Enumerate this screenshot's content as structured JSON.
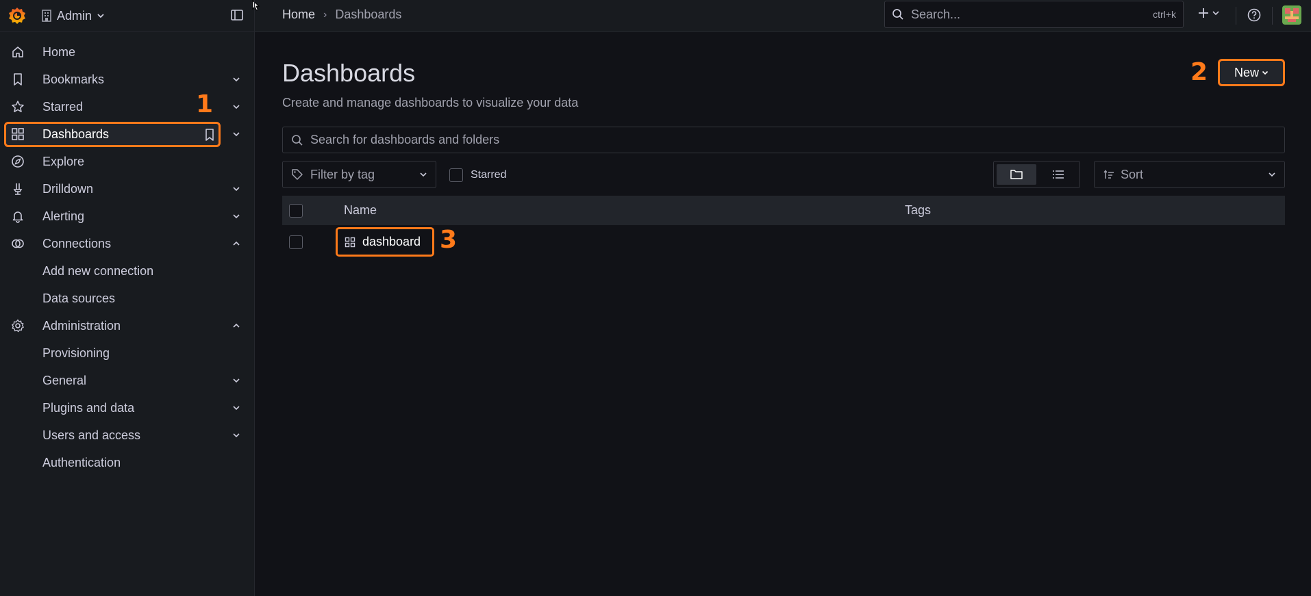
{
  "topbar": {
    "org_name": "Admin",
    "breadcrumb_home": "Home",
    "breadcrumb_separator": "›",
    "breadcrumb_current": "Dashboards",
    "search_placeholder": "Search...",
    "search_shortcut": "ctrl+k",
    "add_label": "+"
  },
  "sidebar": {
    "items": [
      {
        "label": "Home",
        "icon": "home-icon"
      },
      {
        "label": "Bookmarks",
        "icon": "bookmark-icon"
      },
      {
        "label": "Starred",
        "icon": "star-icon"
      },
      {
        "label": "Dashboards",
        "icon": "apps-icon"
      },
      {
        "label": "Explore",
        "icon": "compass-icon"
      },
      {
        "label": "Drilldown",
        "icon": "drilldown-icon"
      },
      {
        "label": "Alerting",
        "icon": "bell-icon"
      },
      {
        "label": "Connections",
        "icon": "link-icon"
      },
      {
        "label": "Add new connection"
      },
      {
        "label": "Data sources"
      },
      {
        "label": "Administration",
        "icon": "cog-icon"
      },
      {
        "label": "Provisioning"
      },
      {
        "label": "General"
      },
      {
        "label": "Plugins and data"
      },
      {
        "label": "Users and access"
      },
      {
        "label": "Authentication"
      }
    ]
  },
  "annotations": {
    "one": "1",
    "two": "2",
    "three": "3"
  },
  "main": {
    "title": "Dashboards",
    "subtitle": "Create and manage dashboards to visualize your data",
    "new_button": "New",
    "search_placeholder": "Search for dashboards and folders",
    "filter_placeholder": "Filter by tag",
    "starred_label": "Starred",
    "sort_placeholder": "Sort",
    "columns": {
      "name": "Name",
      "tags": "Tags"
    },
    "rows": [
      {
        "name": "dashboard",
        "tags": ""
      }
    ]
  },
  "colors": {
    "accent_annotation": "#ff7a1a",
    "background": "#111217",
    "panel": "#181b1f"
  }
}
